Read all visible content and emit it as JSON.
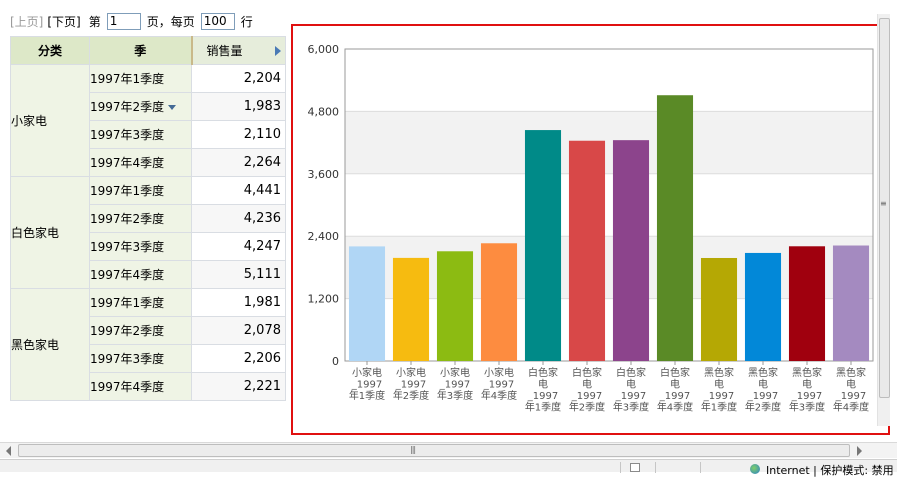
{
  "pager": {
    "prev": "[上页]",
    "next": "[下页]",
    "page_prefix": "第",
    "page_value": "1",
    "page_suffix": "页，每页",
    "rows_value": "100",
    "rows_suffix": "行"
  },
  "table": {
    "headers": {
      "category": "分类",
      "season": "季",
      "sales": "销售量"
    },
    "rows": [
      {
        "category": "小家电",
        "season": "1997年1季度",
        "value": "2,204"
      },
      {
        "category": "",
        "season": "1997年2季度",
        "value": "1,983"
      },
      {
        "category": "",
        "season": "1997年3季度",
        "value": "2,110"
      },
      {
        "category": "",
        "season": "1997年4季度",
        "value": "2,264"
      },
      {
        "category": "白色家电",
        "season": "1997年1季度",
        "value": "4,441"
      },
      {
        "category": "",
        "season": "1997年2季度",
        "value": "4,236"
      },
      {
        "category": "",
        "season": "1997年3季度",
        "value": "4,247"
      },
      {
        "category": "",
        "season": "1997年4季度",
        "value": "5,111"
      },
      {
        "category": "黑色家电",
        "season": "1997年1季度",
        "value": "1,981"
      },
      {
        "category": "",
        "season": "1997年2季度",
        "value": "2,078"
      },
      {
        "category": "",
        "season": "1997年3季度",
        "value": "2,206"
      },
      {
        "category": "",
        "season": "1997年4季度",
        "value": "2,221"
      }
    ]
  },
  "chart_data": {
    "type": "bar",
    "categories": [
      [
        "小家电",
        "_1997",
        "年1季度"
      ],
      [
        "小家电",
        "_1997",
        "年2季度"
      ],
      [
        "小家电",
        "_1997",
        "年3季度"
      ],
      [
        "小家电",
        "_1997",
        "年4季度"
      ],
      [
        "白色家",
        "电",
        "_1997",
        "年1季度"
      ],
      [
        "白色家",
        "电",
        "_1997",
        "年2季度"
      ],
      [
        "白色家",
        "电",
        "_1997",
        "年3季度"
      ],
      [
        "白色家",
        "电",
        "_1997",
        "年4季度"
      ],
      [
        "黑色家",
        "电",
        "_1997",
        "年1季度"
      ],
      [
        "黑色家",
        "电",
        "_1997",
        "年2季度"
      ],
      [
        "黑色家",
        "电",
        "_1997",
        "年3季度"
      ],
      [
        "黑色家",
        "电",
        "_1997",
        "年4季度"
      ]
    ],
    "values": [
      2204,
      1983,
      2110,
      2264,
      4441,
      4236,
      4247,
      5111,
      1981,
      2078,
      2206,
      2221
    ],
    "colors": [
      "#b0d6f5",
      "#f6bb10",
      "#8cbb12",
      "#fd8c40",
      "#008a88",
      "#d84848",
      "#8c448c",
      "#5a8a26",
      "#b5a804",
      "#0288d8",
      "#a0000e",
      "#a48ac0"
    ],
    "yticks": [
      "0",
      "1,200",
      "2,400",
      "3,600",
      "4,800",
      "6,000"
    ],
    "ylim": [
      0,
      6000
    ],
    "ystep": 1200,
    "grid": true,
    "band_color": "#f2f2f2",
    "title": "",
    "xlabel": "",
    "ylabel": ""
  },
  "statusbar": {
    "zone_text": "Internet | 保护模式: 禁用"
  }
}
